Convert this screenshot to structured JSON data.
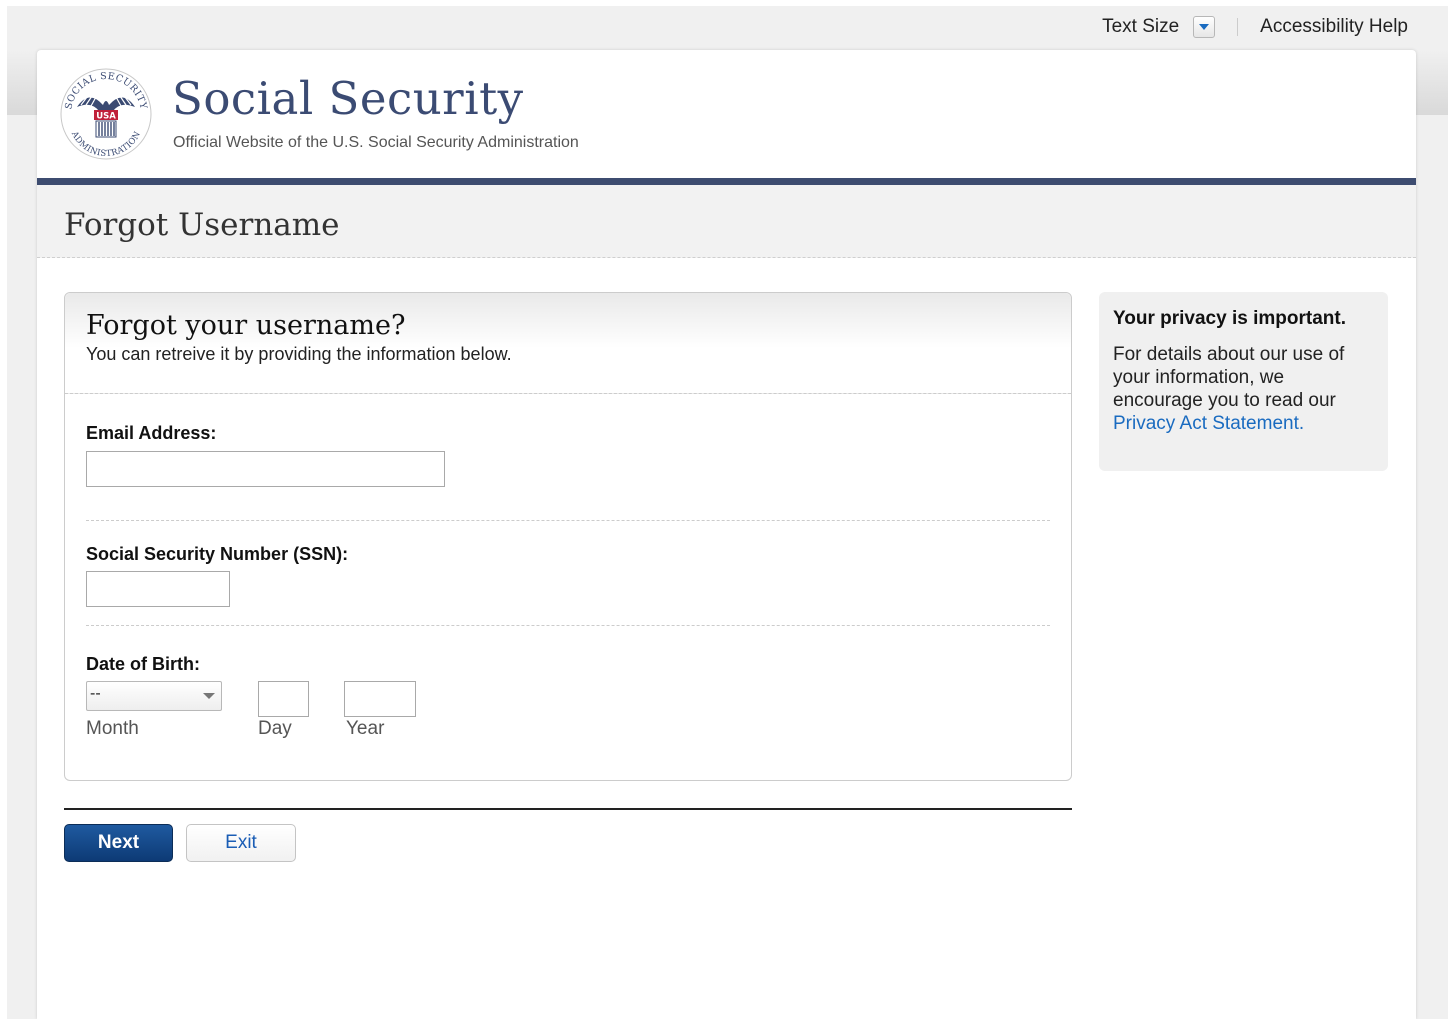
{
  "utility_bar": {
    "text_size_label": "Text Size",
    "accessibility_label": "Accessibility Help"
  },
  "header": {
    "seal_text": {
      "ring_top": "SOCIAL SECURITY",
      "ring_bottom": "ADMINISTRATION",
      "center": "USA"
    },
    "title": "Social Security",
    "subtitle": "Official Website of the U.S. Social Security Administration"
  },
  "page": {
    "title": "Forgot Username"
  },
  "form": {
    "heading": "Forgot your username?",
    "intro": "You can retreive it by providing the information below.",
    "email": {
      "label": "Email Address:",
      "value": ""
    },
    "ssn": {
      "label": "Social Security Number (SSN):",
      "value": ""
    },
    "dob": {
      "label": "Date of Birth:",
      "month_selected": "--",
      "month_label": "Month",
      "day_label": "Day",
      "year_label": "Year",
      "day_value": "",
      "year_value": ""
    }
  },
  "actions": {
    "next_label": "Next",
    "exit_label": "Exit"
  },
  "privacy": {
    "title": "Your privacy is important.",
    "body": "For details about our use of your information, we encourage you to read our",
    "link_label": "Privacy Act Statement."
  },
  "colors": {
    "brand_navy": "#3d4c70",
    "link_blue": "#1a6bc0",
    "primary_button": "#0d3a75"
  }
}
